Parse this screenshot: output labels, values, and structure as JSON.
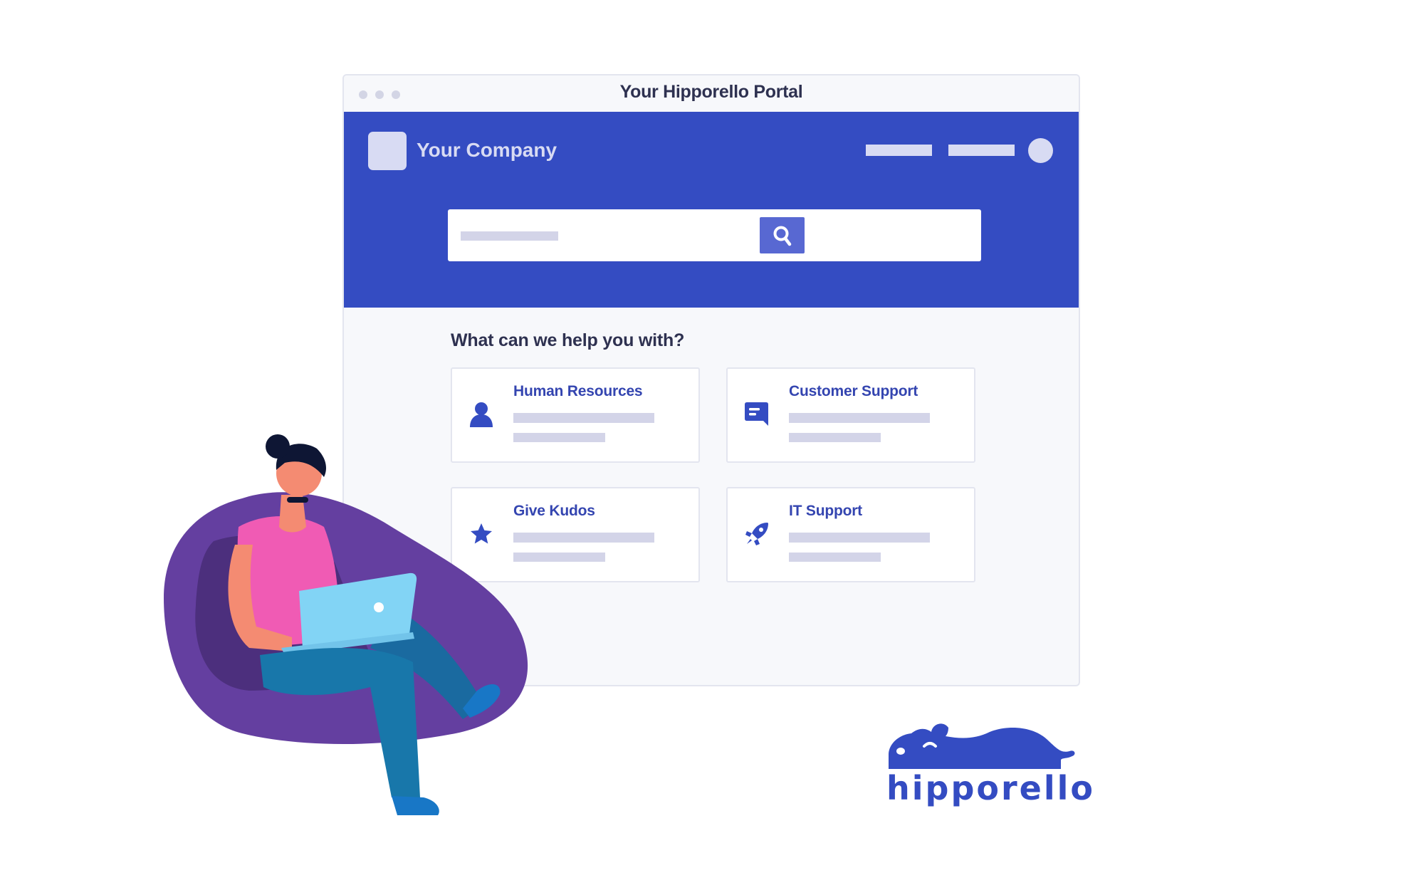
{
  "window": {
    "title": "Your Hipporello Portal",
    "controls": [
      "dot",
      "dot",
      "dot"
    ]
  },
  "header": {
    "company_name": "Your Company",
    "logo_icon": "company-logo-placeholder",
    "nav_placeholders": 2,
    "avatar_icon": "user-avatar-placeholder",
    "brand_color": "#344cc2"
  },
  "search": {
    "placeholder": "",
    "button_icon": "search-icon"
  },
  "main": {
    "heading": "What can we help you with?",
    "cards": [
      {
        "title": "Human Resources",
        "icon": "person-icon"
      },
      {
        "title": "Customer Support",
        "icon": "chat-icon"
      },
      {
        "title": "Give Kudos",
        "icon": "star-icon"
      },
      {
        "title": "IT Support",
        "icon": "rocket-icon"
      }
    ]
  },
  "brand": {
    "name": "hipporello",
    "color": "#344cc2"
  }
}
